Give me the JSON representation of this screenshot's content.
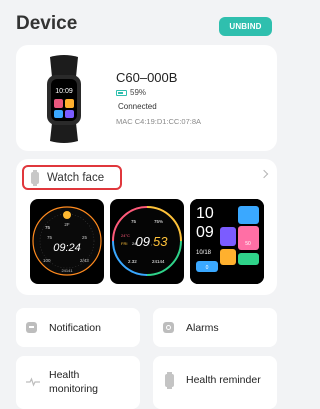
{
  "header": {
    "title": "Device",
    "unbind_label": "UNBIND"
  },
  "device": {
    "name": "C60–000B",
    "battery_percent_text": "59%",
    "battery_level": 0.59,
    "status": "Connected",
    "mac": "MAC C4:19:D1:CC:07:8A",
    "image_icon": "fitness-band-image"
  },
  "watch_face": {
    "label": "Watch face",
    "faces": [
      {
        "time": "09:24",
        "top_left": "75",
        "top_right": "2F",
        "mid_left": "75",
        "mid_right": "25",
        "bottom_left": "100",
        "bottom_right": "2/43",
        "steps": "24141"
      },
      {
        "hour": "09",
        "minute": "53",
        "date_label": "FRI",
        "date_day": "24",
        "top_left": "75",
        "top_right": "75%",
        "mid_left": "24°C",
        "bottom_left": "2.32",
        "bottom_right": "24144"
      },
      {
        "hour": "10",
        "minute": "09",
        "date": "10/18",
        "tile_a": "50",
        "tile_b": "0"
      }
    ]
  },
  "tiles": {
    "notification": "Notification",
    "alarms": "Alarms",
    "health_monitoring_line1": "Health",
    "health_monitoring_line2": "monitoring",
    "health_reminder": "Health reminder"
  },
  "colors": {
    "accent": "#2fbfae",
    "highlight": "#e0373c",
    "background": "#f2f3f5"
  }
}
